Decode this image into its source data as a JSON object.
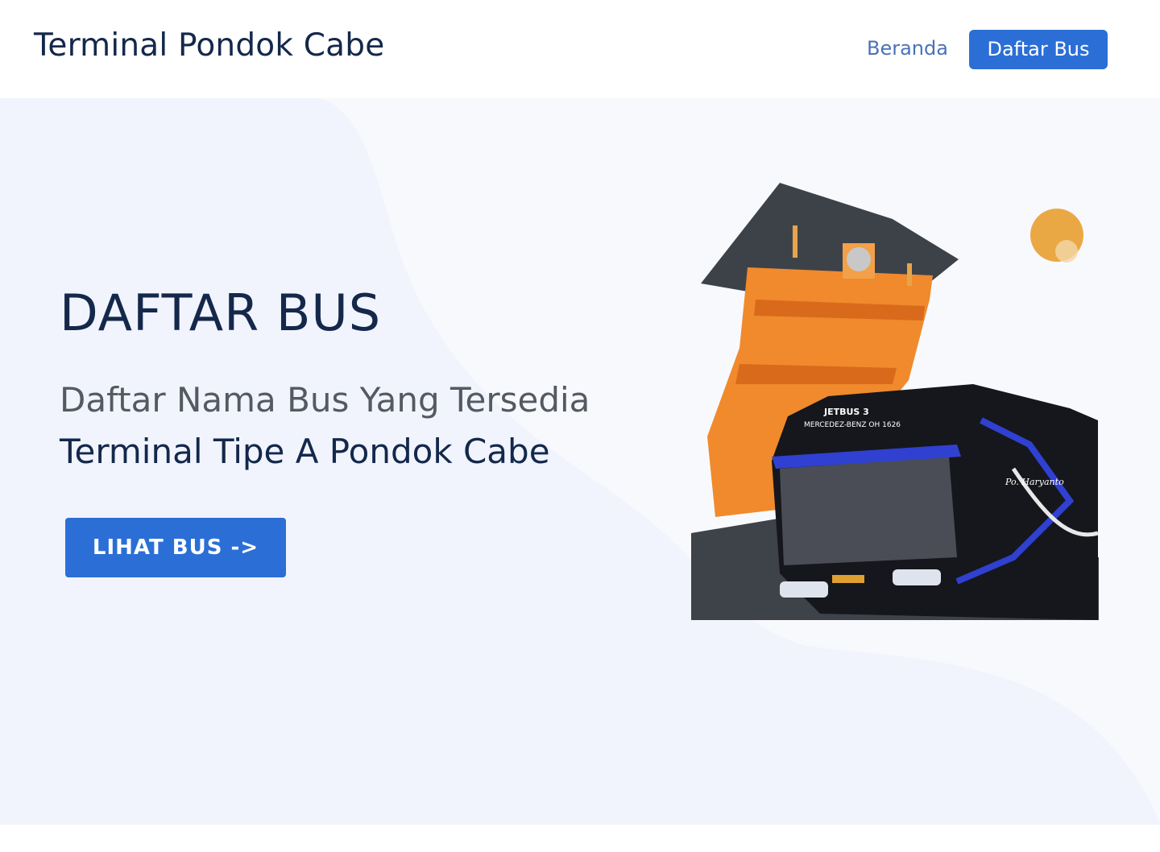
{
  "navbar": {
    "brand": "Terminal Pondok Cabe",
    "links": [
      {
        "label": "Beranda"
      },
      {
        "label": "Daftar Bus"
      }
    ]
  },
  "hero": {
    "title": "DAFTAR BUS",
    "subtitle_line1": "Daftar Nama Bus Yang Tersedia",
    "subtitle_line2": "Terminal Tipe A Pondok Cabe",
    "cta_label": "LIHAT BUS ->",
    "illustration": {
      "icon": "bus-terminal-illustration",
      "bus_text": [
        "JETBUS 3",
        "MERCEDEZ-BENZ OH 1626",
        "Po. Haryanto"
      ]
    }
  },
  "colors": {
    "primary": "#2b6fd6",
    "heading": "#14284b",
    "hero_bg": "#f1f4fc",
    "tower": "#f08a2c",
    "roof": "#3d4249",
    "sun": "#eaa844"
  }
}
